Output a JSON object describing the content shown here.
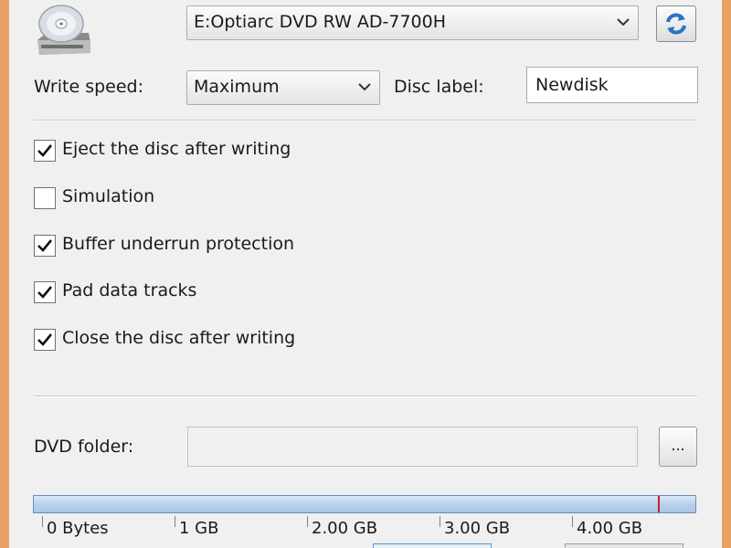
{
  "drive": {
    "icon": "optical-drive-icon",
    "selected": "E:Optiarc DVD RW AD-7700H",
    "refresh_icon": "refresh-icon"
  },
  "write_speed": {
    "label": "Write speed:",
    "selected": "Maximum"
  },
  "disc_label": {
    "label": "Disc label:",
    "value": "Newdisk"
  },
  "options": [
    {
      "label": "Eject the disc after writing",
      "checked": true
    },
    {
      "label": "Simulation",
      "checked": false
    },
    {
      "label": "Buffer underrun protection",
      "checked": true
    },
    {
      "label": "Pad data tracks",
      "checked": true
    },
    {
      "label": "Close the disc after writing",
      "checked": true
    }
  ],
  "dvd_folder": {
    "label": "DVD folder:",
    "value": "",
    "browse_label": "..."
  },
  "capacity": {
    "limit_fraction": 0.943,
    "scale": [
      "0 Bytes",
      "1 GB",
      "2.00 GB",
      "3.00 GB",
      "4.00 GB"
    ]
  },
  "colors": {
    "window_frame": "#e8a263",
    "bar_fill": "#b7d0ea",
    "limit_marker": "#c8202a"
  }
}
